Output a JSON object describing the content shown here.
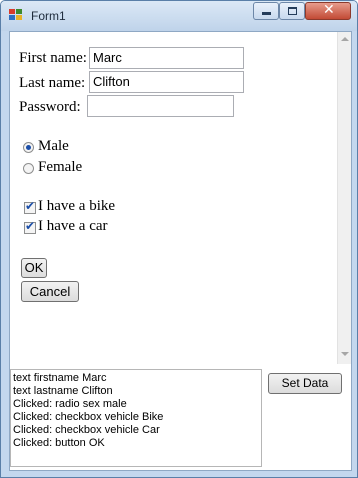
{
  "window": {
    "title": "Form1"
  },
  "form": {
    "first_name_label": "First name:",
    "first_name_value": "Marc",
    "last_name_label": "Last name:",
    "last_name_value": "Clifton",
    "password_label": "Password:",
    "password_value": "",
    "radio_male_label": "Male",
    "radio_male_checked": true,
    "radio_female_label": "Female",
    "radio_female_checked": false,
    "check_bike_label": "I have a bike",
    "check_bike_checked": true,
    "check_car_label": "I have a car",
    "check_car_checked": true,
    "ok_label": "OK",
    "cancel_label": "Cancel"
  },
  "log": {
    "lines": [
      "text firstname Marc",
      "text lastname Clifton",
      "Clicked: radio sex male",
      "Clicked: checkbox vehicle Bike",
      "Clicked: checkbox vehicle Car",
      "Clicked: button  OK"
    ],
    "set_data_label": "Set Data"
  }
}
